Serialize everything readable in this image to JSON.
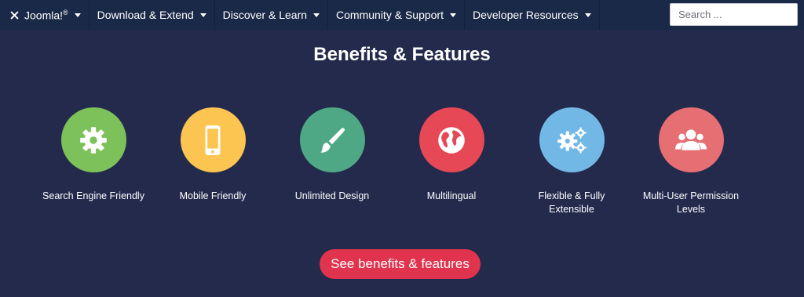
{
  "nav": {
    "brand": "Joomla!",
    "brand_mark": "®",
    "items": [
      {
        "label": "Download & Extend"
      },
      {
        "label": "Discover & Learn"
      },
      {
        "label": "Community & Support"
      },
      {
        "label": "Developer Resources"
      }
    ],
    "search_placeholder": "Search ..."
  },
  "section": {
    "title": "Benefits & Features",
    "features": [
      {
        "label": "Search Engine Friendly",
        "icon": "gear-icon",
        "color": "#7dc15a"
      },
      {
        "label": "Mobile Friendly",
        "icon": "mobile-phone-icon",
        "color": "#fcc451"
      },
      {
        "label": "Unlimited Design",
        "icon": "paintbrush-icon",
        "color": "#4ea886"
      },
      {
        "label": "Multilingual",
        "icon": "globe-icon",
        "color": "#e74856"
      },
      {
        "label": "Flexible & Fully Extensible",
        "icon": "gears-icon",
        "color": "#72b8e6"
      },
      {
        "label": "Multi-User Permission Levels",
        "icon": "users-icon",
        "color": "#e56f73"
      }
    ],
    "cta_label": "See benefits & features"
  }
}
